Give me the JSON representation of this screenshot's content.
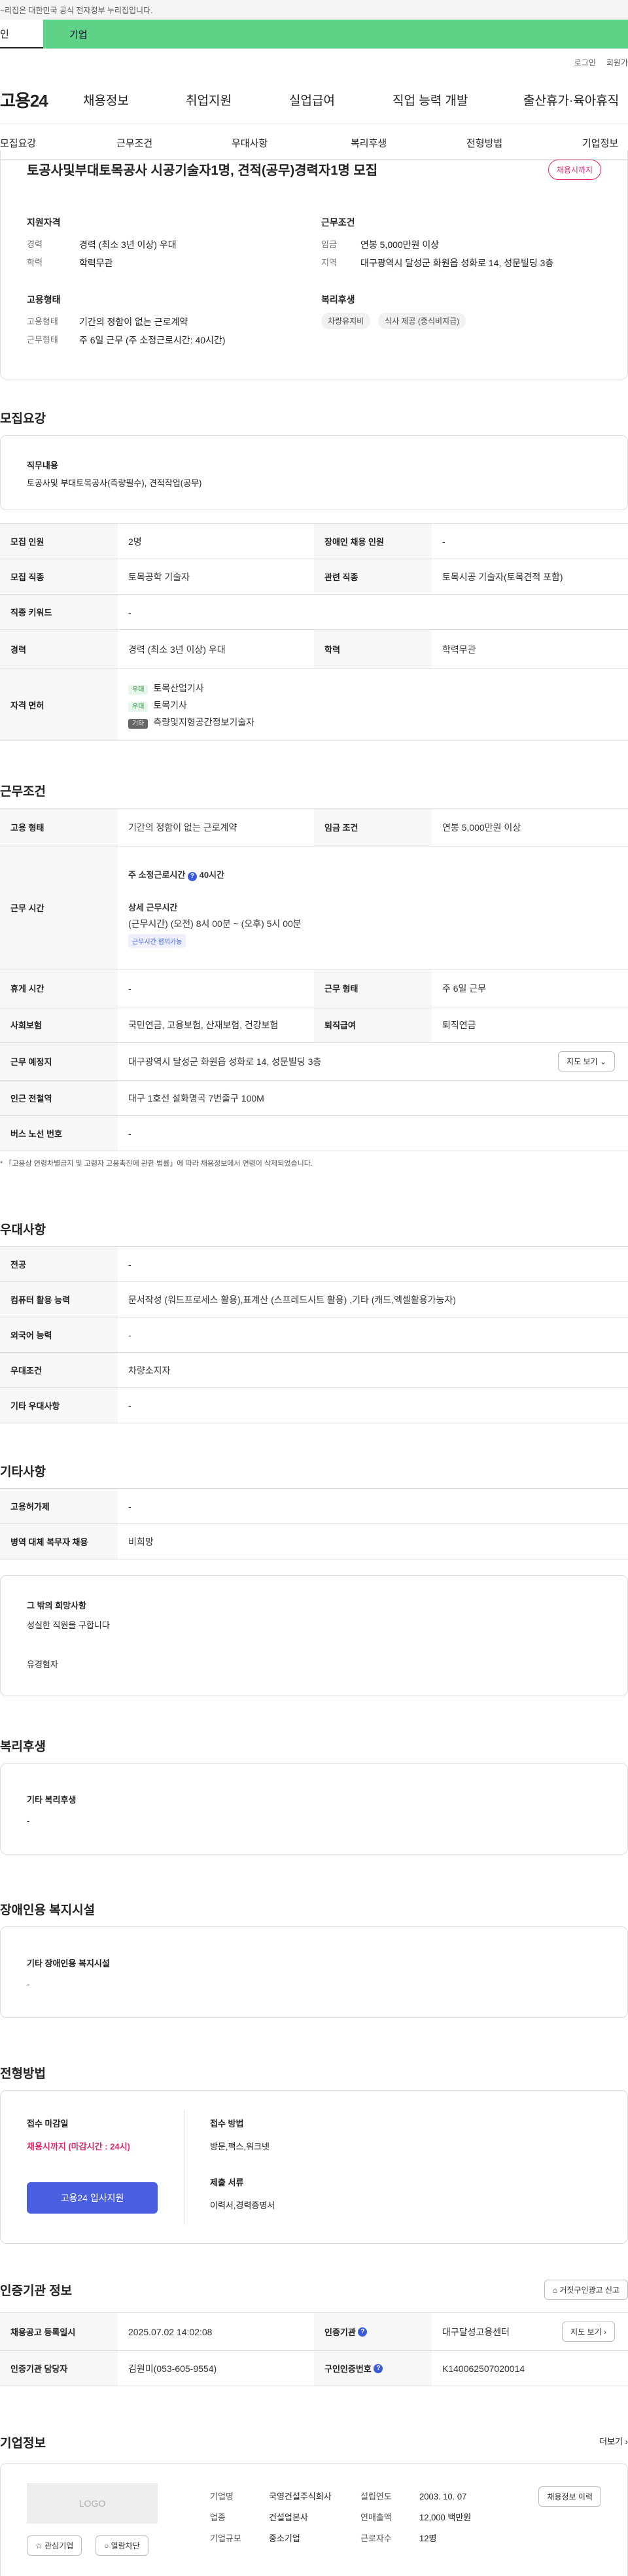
{
  "gov_banner": "~리집은 대한민국 공식 전자정부 누리집입니다.",
  "user_tabs": [
    "인",
    "기업"
  ],
  "util": [
    "로그인",
    "회원가"
  ],
  "gnb": {
    "logo": "고용24",
    "menus": [
      "채용정보",
      "취업지원",
      "실업급여",
      "직업 능력 개발",
      "출산휴가·육아휴직"
    ]
  },
  "lnb": [
    "모집요강",
    "근무조건",
    "우대사항",
    "복리후생",
    "전형방법",
    "기업정보"
  ],
  "summary": {
    "title": "토공사및부대토목공사 시공기술자1명, 견적(공무)경력자1명 모집",
    "badge": "채용시까지",
    "qual_title": "지원자격",
    "qual": [
      {
        "k": "경력",
        "v": "경력 (최소 3년 이상) 우대"
      },
      {
        "k": "학력",
        "v": "학력무관"
      }
    ],
    "emp_title": "고용형태",
    "emp": [
      {
        "k": "고용형태",
        "v": "기간의 정함이 없는 근로계약"
      },
      {
        "k": "근무형태",
        "v": "주 6일 근무 (주 소정근로시간: 40시간)"
      }
    ],
    "cond_title": "근무조건",
    "cond": [
      {
        "k": "임금",
        "v": "연봉 5,000만원 이상"
      },
      {
        "k": "지역",
        "v": "대구광역시 달성군 화원읍 성화로 14, 성문빌딩 3층"
      }
    ],
    "welfare_title": "복리후생",
    "welfare": [
      "차량유지비",
      "식사 제공 (중식비지급)"
    ]
  },
  "recruit": {
    "heading": "모집요강",
    "duty_label": "직무내용",
    "duty": "토공사및 부대토목공사(측량필수), 견적작업(공무)",
    "rows": [
      {
        "a": "모집 인원",
        "av": "2명",
        "b": "장애인 채용 인원",
        "bv": "-"
      },
      {
        "a": "모집 직종",
        "av": "토목공학 기술자",
        "b": "관련 직종",
        "bv": "토목시공 기술자(토목견적 포함)"
      },
      {
        "a": "직종 키워드",
        "av": "-"
      },
      {
        "a": "경력",
        "av": "경력 (최소 3년 이상) 우대",
        "b": "학력",
        "bv": "학력무관"
      }
    ],
    "license_label": "자격 면허",
    "licenses": [
      {
        "tag": "우대",
        "name": "토목산업기사"
      },
      {
        "tag": "우대",
        "name": "토목기사"
      },
      {
        "tag": "기타",
        "name": "측량및지형공간정보기술자 "
      }
    ]
  },
  "work": {
    "heading": "근무조건",
    "emp_type": {
      "label": "고용 형태",
      "value": "기간의 정함이 없는 근로계약",
      "wage_label": "임금 조건",
      "wage": "연봉 5,000만원 이상"
    },
    "hours": {
      "label": "근무 시간",
      "weekly": "주 소정근로시간",
      "weekly_value": "40시간",
      "detail_title": "상세 근무시간",
      "detail": "(근무시간) (오전) 8시 00분 ~ (오후) 5시 00분",
      "chip": "근무시간 협의가능"
    },
    "rest": {
      "label": "휴게 시간",
      "value": "-",
      "type_label": "근무 형태",
      "type": "주 6일 근무"
    },
    "ins": {
      "label": "사회보험",
      "value": "국민연금, 고용보험, 산재보험, 건강보험",
      "ret_label": "퇴직급여",
      "ret": "퇴직연금"
    },
    "place": {
      "label": "근무 예정지",
      "value": "대구광역시 달성군 화원읍 성화로 14, 성문빌딩 3층",
      "btn": "지도 보기"
    },
    "station": {
      "label": "인근 전철역",
      "value": "대구 1호선 설화명곡 7번출구 100M"
    },
    "bus": {
      "label": "버스 노선 번호",
      "value": "-"
    },
    "note": "「고용상 연령차별금지 및 고령자 고용촉진에 관한 법률」에 따라 채용정보에서 연령이 삭제되었습니다."
  },
  "prefer": {
    "heading": "우대사항",
    "rows": [
      {
        "k": "전공",
        "v": "-"
      },
      {
        "k": "컴퓨터 활용 능력",
        "v": "문서작성 (워드프로세스 활용),표계산 (스프레드시트 활용) ,기타 (캐드,엑셀활용가능자)"
      },
      {
        "k": "외국어 능력",
        "v": "-"
      },
      {
        "k": "우대조건",
        "v": "차량소지자"
      },
      {
        "k": "기타 우대사항",
        "v": "-"
      }
    ]
  },
  "etc": {
    "heading": "기타사항",
    "rows": [
      {
        "k": "고용허가제",
        "v": "-"
      },
      {
        "k": "병역 대체 복무자 채용",
        "v": "비희망"
      }
    ],
    "wish_title": "그 밖의 희망사항",
    "wish_lines": [
      "성실한 직원을 구합니다",
      "유경험자"
    ]
  },
  "welfare": {
    "heading": "복리후생",
    "sub": "기타 복리후생",
    "value": "-"
  },
  "disabled": {
    "heading": "장애인용 복지시설",
    "sub": "기타 장애인용 복지시설",
    "value": "-"
  },
  "process": {
    "heading": "전형방법",
    "deadline_title": "접수 마감일",
    "deadline": "채용시까지 (마감시간 : 24시)",
    "apply_btn": "고용24 입사지원",
    "method_title": "접수 방법",
    "method": "방문,팩스,워크넷",
    "docs_title": "제출 서류",
    "docs": "이력서,경력증명서"
  },
  "cert": {
    "heading": "인증기관 정보",
    "report_btn": "거짓구인광고 신고",
    "rows": [
      {
        "a": "채용공고 등록일시",
        "av": "2025.07.02 14:02:08",
        "b": "인증기관",
        "bv": "대구달성고용센터",
        "btn": "지도 보기"
      },
      {
        "a": "인증기관 담당자",
        "av": "김원미(053-605-9554)",
        "b": "구인인증번호",
        "bv": "K140062507020014"
      }
    ]
  },
  "company": {
    "heading": "기업정보",
    "more": "더보기",
    "logo": "LOGO",
    "fav": "관심기업",
    "block": "열람차단",
    "history_btn": "채용정보 이력",
    "info": [
      {
        "k": "기업명",
        "v": "국영건설주식회사",
        "k2": "설립연도",
        "v2": "2003. 10. 07"
      },
      {
        "k": "업종",
        "v": "건설업본사",
        "k2": "연매출액",
        "v2": "12,000 백만원"
      },
      {
        "k": "기업규모",
        "v": "중소기업",
        "k2": "근로자수",
        "v2": "12명"
      }
    ]
  }
}
